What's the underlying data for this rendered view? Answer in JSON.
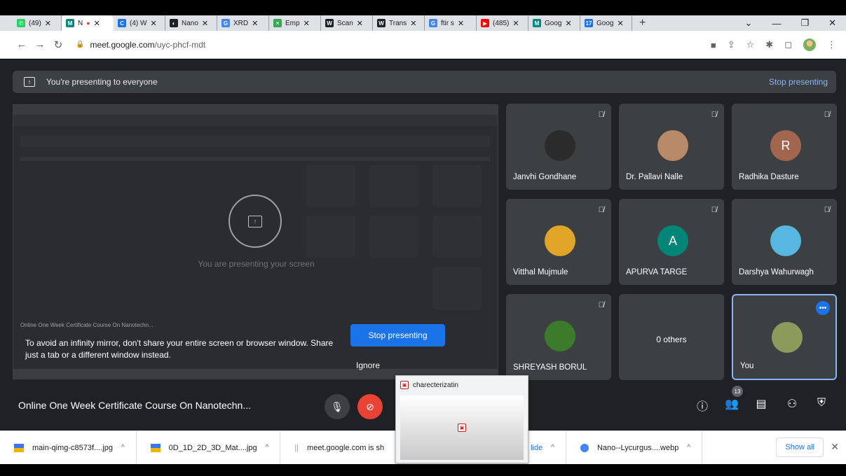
{
  "browser": {
    "tabs": [
      {
        "label": "(49)",
        "color": "#25d366",
        "glyph": "✆"
      },
      {
        "label": "N",
        "color": "#00897b",
        "glyph": "M",
        "active": true,
        "recording": true
      },
      {
        "label": "(4) W",
        "color": "#1a73e8",
        "glyph": "C"
      },
      {
        "label": "Nano",
        "color": "#202124",
        "glyph": "◐"
      },
      {
        "label": "XRD",
        "color": "#4285f4",
        "glyph": "G"
      },
      {
        "label": "Emp",
        "color": "#34a853",
        "glyph": "✕"
      },
      {
        "label": "Scan",
        "color": "#202124",
        "glyph": "W"
      },
      {
        "label": "Trans",
        "color": "#202124",
        "glyph": "W"
      },
      {
        "label": "ftir s",
        "color": "#4285f4",
        "glyph": "G"
      },
      {
        "label": "(485)",
        "color": "#ff0000",
        "glyph": "▶"
      },
      {
        "label": "Goog",
        "color": "#00897b",
        "glyph": "M"
      },
      {
        "label": "Goog",
        "color": "#1a73e8",
        "glyph": "17"
      }
    ],
    "new_tab": "+",
    "window_controls": [
      "⌄",
      "—",
      "❐",
      "✕"
    ],
    "url_host": "meet.google.com",
    "url_path": "/uyc-phcf-mdt"
  },
  "banner": {
    "text": "You're presenting to everyone",
    "stop_link": "Stop presenting"
  },
  "screen_preview": {
    "presenting_text": "You are presenting your screen",
    "mini_title": "Online One Week Certificate Course On Nanotechn...",
    "warning": "To avoid an infinity mirror, don't share your entire screen or browser window. Share just a tab or a different window instead.",
    "stop_button": "Stop presenting",
    "ignore": "Ignore"
  },
  "participants": [
    {
      "name": "Janvhi Gondhane",
      "muted": true,
      "avatar_color": "#2b2b2b"
    },
    {
      "name": "Dr. Pallavi Nalle",
      "muted": true,
      "avatar_color": "#b98a6a"
    },
    {
      "name": "Radhika Dasture",
      "muted": true,
      "initial": "R",
      "avatar_color": "#a1664d"
    },
    {
      "name": "Vitthal Mujmule",
      "muted": true,
      "avatar_color": "#e0a526"
    },
    {
      "name": "APURVA TARGE",
      "muted": true,
      "initial": "A",
      "avatar_color": "#008577"
    },
    {
      "name": "Darshya Wahurwagh",
      "muted": true,
      "avatar_color": "#58b7e0"
    },
    {
      "name": "SHREYASH BORUL",
      "muted": true,
      "avatar_color": "#3c7a2c"
    },
    {
      "others_label": "0 others"
    },
    {
      "name": "You",
      "avatar_color": "#8c9b5c"
    }
  ],
  "bottom": {
    "meeting_title": "Online One Week Certificate Course On Nanotechn...",
    "participant_count": "13"
  },
  "popup": {
    "title": "charecterizatin"
  },
  "downloads": {
    "items": [
      {
        "name": "main-qimg-c8573f....jpg"
      },
      {
        "name": "0D_1D_2D_3D_Mat....jpg"
      },
      {
        "name": "meet.google.com is sh"
      },
      {
        "name": "lide"
      },
      {
        "name": "Nano--Lycurgus....webp"
      }
    ],
    "show_all": "Show all"
  }
}
